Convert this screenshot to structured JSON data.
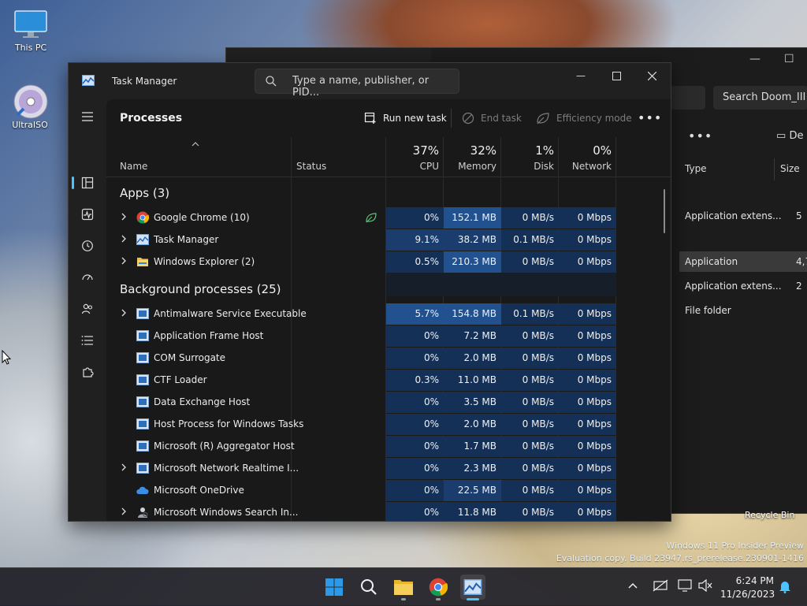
{
  "desktop": {
    "icons": [
      {
        "label": "This PC"
      },
      {
        "label": "UltraISO"
      }
    ],
    "recycle_bin_label": "Recycle Bin",
    "watermark_line1": "Windows 11 Pro Insider Preview",
    "watermark_line2": "Evaluation copy. Build 23947.rs_prerelease.230901-1416"
  },
  "explorer": {
    "search_placeholder": "Search Doom_III",
    "details_label": "De",
    "col_type": "Type",
    "col_size": "Size",
    "rows": [
      {
        "type": "Application extens...",
        "size": "5"
      },
      {
        "type": "Application",
        "size": "4,7"
      },
      {
        "type": "Application extens...",
        "size": "2"
      },
      {
        "type": "File folder",
        "size": ""
      }
    ]
  },
  "task_manager": {
    "title": "Task Manager",
    "search_placeholder": "Type a name, publisher, or PID...",
    "page_title": "Processes",
    "toolbar": {
      "run_new_task": "Run new task",
      "end_task": "End task",
      "efficiency_mode": "Efficiency mode"
    },
    "columns": {
      "name": "Name",
      "status": "Status",
      "cpu_pct": "37%",
      "cpu": "CPU",
      "memory_pct": "32%",
      "memory": "Memory",
      "disk_pct": "1%",
      "disk": "Disk",
      "network_pct": "0%",
      "network": "Network"
    },
    "groups": {
      "apps": "Apps (3)",
      "background": "Background processes (25)"
    },
    "apps": [
      {
        "name": "Google Chrome (10)",
        "cpu": "0%",
        "memory": "152.1 MB",
        "disk": "0 MB/s",
        "network": "0 Mbps"
      },
      {
        "name": "Task Manager",
        "cpu": "9.1%",
        "memory": "38.2 MB",
        "disk": "0.1 MB/s",
        "network": "0 Mbps"
      },
      {
        "name": "Windows Explorer (2)",
        "cpu": "0.5%",
        "memory": "210.3 MB",
        "disk": "0 MB/s",
        "network": "0 Mbps"
      }
    ],
    "background": [
      {
        "name": "Antimalware Service Executable",
        "cpu": "5.7%",
        "memory": "154.8 MB",
        "disk": "0.1 MB/s",
        "network": "0 Mbps"
      },
      {
        "name": "Application Frame Host",
        "cpu": "0%",
        "memory": "7.2 MB",
        "disk": "0 MB/s",
        "network": "0 Mbps"
      },
      {
        "name": "COM Surrogate",
        "cpu": "0%",
        "memory": "2.0 MB",
        "disk": "0 MB/s",
        "network": "0 Mbps"
      },
      {
        "name": "CTF Loader",
        "cpu": "0.3%",
        "memory": "11.0 MB",
        "disk": "0 MB/s",
        "network": "0 Mbps"
      },
      {
        "name": "Data Exchange Host",
        "cpu": "0%",
        "memory": "3.5 MB",
        "disk": "0 MB/s",
        "network": "0 Mbps"
      },
      {
        "name": "Host Process for Windows Tasks",
        "cpu": "0%",
        "memory": "2.0 MB",
        "disk": "0 MB/s",
        "network": "0 Mbps"
      },
      {
        "name": "Microsoft (R) Aggregator Host",
        "cpu": "0%",
        "memory": "1.7 MB",
        "disk": "0 MB/s",
        "network": "0 Mbps"
      },
      {
        "name": "Microsoft Network Realtime I...",
        "cpu": "0%",
        "memory": "2.3 MB",
        "disk": "0 MB/s",
        "network": "0 Mbps"
      },
      {
        "name": "Microsoft OneDrive",
        "cpu": "0%",
        "memory": "22.5 MB",
        "disk": "0 MB/s",
        "network": "0 Mbps"
      },
      {
        "name": "Microsoft Windows Search In...",
        "cpu": "0%",
        "memory": "11.8 MB",
        "disk": "0 MB/s",
        "network": "0 Mbps"
      }
    ]
  },
  "taskbar": {
    "time": "6:24 PM",
    "date": "11/26/2023"
  },
  "colors": {
    "accent": "#4cc2ff",
    "heat_low": "#153056",
    "heat_mid": "#1a3d6e",
    "heat_high": "#22518f",
    "window_bg": "#202020"
  }
}
